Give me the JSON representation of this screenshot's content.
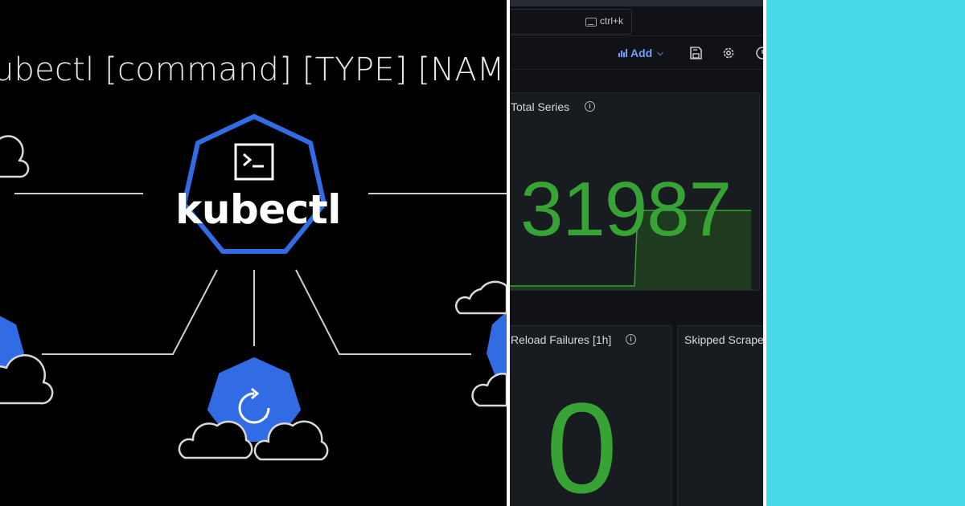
{
  "kubectl_graphic": {
    "command_syntax": "ubectl [command] [TYPE] [NAME] [f",
    "logo_label": "kubectl",
    "center_icon": "terminal-prompt-icon",
    "bottom_icon": "refresh-circle-icon",
    "colors": {
      "background": "#000000",
      "hex_blue": "#326ce5",
      "lines": "#cfcfcf"
    }
  },
  "dashboard": {
    "search_shortcut": "ctrl+k",
    "toolbar": {
      "add_label": "Add",
      "icons": [
        "add-panel-icon",
        "save-icon",
        "gear-icon",
        "clock-icon"
      ]
    },
    "panels": {
      "total_series": {
        "title": "Total Series",
        "value": "31987",
        "value_color": "#37a334"
      },
      "reload_failures": {
        "title": "Reload Failures [1h]",
        "value": "0",
        "value_color": "#37a334"
      },
      "skipped_scrapes": {
        "title": "Skipped Scrape"
      }
    },
    "colors": {
      "background": "#111217",
      "panel": "#181b1f",
      "accent_blue": "#6e9fff",
      "ok_green": "#37a334"
    }
  },
  "right_panel": {
    "color": "#48d9e8"
  }
}
